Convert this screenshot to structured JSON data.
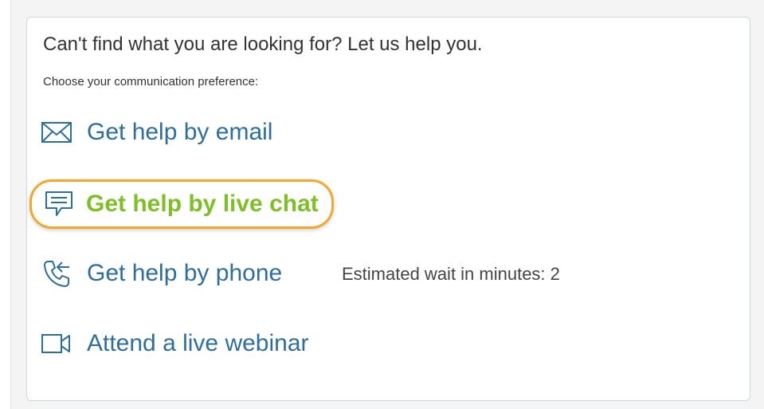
{
  "help": {
    "heading": "Can't find what you are looking for? Let us help you.",
    "subheading": "Choose your communication preference:",
    "options": [
      {
        "label": "Get help by email",
        "icon": "envelope-icon"
      },
      {
        "label": "Get help by live chat",
        "icon": "chat-icon"
      },
      {
        "label": "Get help by phone",
        "icon": "phone-icon"
      },
      {
        "label": "Attend a live webinar",
        "icon": "video-camera-icon"
      }
    ],
    "wait_text": "Estimated wait in minutes: 2"
  },
  "colors": {
    "link": "#2f6d9c",
    "highlight_text": "#7ebf28",
    "highlight_border": "#f0a830"
  }
}
